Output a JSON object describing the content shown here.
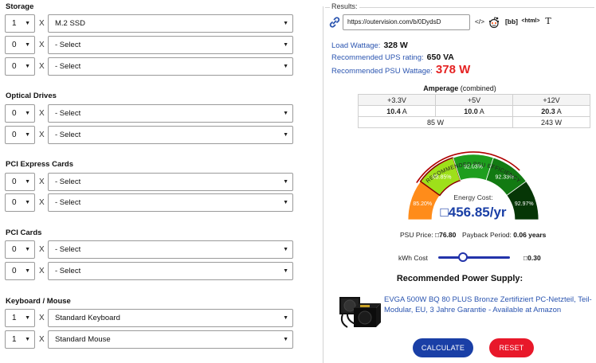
{
  "sections": {
    "storage": {
      "title": "Storage",
      "rows": [
        {
          "qty": "1",
          "value": "M.2 SSD"
        },
        {
          "qty": "0",
          "value": "- Select"
        },
        {
          "qty": "0",
          "value": "- Select"
        }
      ]
    },
    "optical": {
      "title": "Optical Drives",
      "rows": [
        {
          "qty": "0",
          "value": "- Select"
        },
        {
          "qty": "0",
          "value": "- Select"
        }
      ]
    },
    "pcie": {
      "title": "PCI Express Cards",
      "rows": [
        {
          "qty": "0",
          "value": "- Select"
        },
        {
          "qty": "0",
          "value": "- Select"
        }
      ]
    },
    "pci": {
      "title": "PCI Cards",
      "rows": [
        {
          "qty": "0",
          "value": "- Select"
        },
        {
          "qty": "0",
          "value": "- Select"
        }
      ]
    },
    "kbm": {
      "title": "Keyboard / Mouse",
      "rows": [
        {
          "qty": "1",
          "value": "Standard Keyboard"
        },
        {
          "qty": "1",
          "value": "Standard Mouse"
        }
      ]
    }
  },
  "multiplier_symbol": "X",
  "results": {
    "legend": "Results:",
    "url": "https://outervision.com/b/0DydsD",
    "share_buttons": [
      "</>",
      "[bb]",
      "<html>",
      "T"
    ],
    "load_wattage_label": "Load Wattage:",
    "load_wattage_value": "328 W",
    "ups_label": "Recommended UPS rating:",
    "ups_value": "650 VA",
    "psu_label": "Recommended PSU Wattage:",
    "psu_value": "378 W"
  },
  "amperage": {
    "title": "Amperage",
    "subtitle": "(combined)",
    "headers": [
      "+3.3V",
      "+5V",
      "+12V"
    ],
    "values": [
      "10.4",
      "10.0",
      "20.3"
    ],
    "unit": "A",
    "watt_row": [
      "85 W",
      "243 W"
    ]
  },
  "gauge": {
    "arc_label": "RECOMMENDED PSU EFFICIENCY",
    "segments": [
      {
        "label": "85.20%",
        "color": "#ff8c1a"
      },
      {
        "label": "88.85%",
        "color": "#9ee01a"
      },
      {
        "label": "92.03%",
        "color": "#1e9e1e"
      },
      {
        "label": "92.33%",
        "color": "#127a12"
      },
      {
        "label": "92.97%",
        "color": "#063606"
      }
    ],
    "highlight_index": 1,
    "energy_cost_label": "Energy Cost:",
    "energy_cost_value": "□456.85/yr"
  },
  "costs": {
    "psu_price_label": "PSU Price:",
    "psu_price_value": "□76.80",
    "payback_label": "Payback Period:",
    "payback_value": "0.06 years",
    "kwh_label": "kWh Cost",
    "kwh_value": "□0.30",
    "kwh_slider_fraction": 0.33
  },
  "recommended": {
    "title": "Recommended Power Supply:",
    "product": "EVGA 500W BQ 80 PLUS Bronze Zertifiziert PC-Netzteil, Teil-Modular, EU, 3 Jahre Garantie - Available at Amazon"
  },
  "buttons": {
    "calculate": "CALCULATE",
    "reset": "RESET"
  },
  "colors": {
    "link_blue": "#2b55b0",
    "psu_red": "#e52222",
    "calculate_bg": "#1a3fa6",
    "reset_bg": "#e8182a"
  }
}
